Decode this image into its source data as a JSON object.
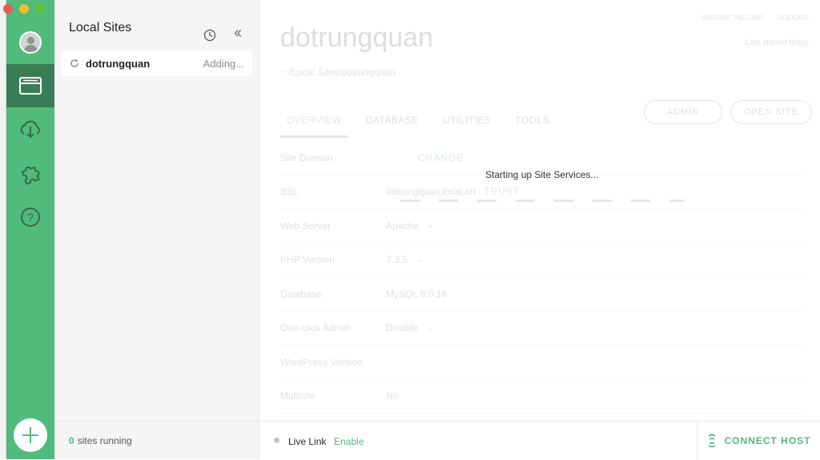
{
  "window": {
    "controls": [
      "close",
      "minimize",
      "maximize"
    ]
  },
  "sidebar": {
    "items": [
      {
        "icon": "sites-icon",
        "active": true
      },
      {
        "icon": "cloud-download-icon",
        "active": false
      },
      {
        "icon": "addons-puzzle-icon",
        "active": false
      },
      {
        "icon": "help-icon",
        "active": false
      }
    ],
    "add_icon": "plus-icon",
    "accent": "#51bb7b",
    "active_bg": "#3a7d55"
  },
  "sites_panel": {
    "title": "Local Sites",
    "sites": [
      {
        "name": "dotrungquan",
        "status": "Adding..."
      }
    ],
    "footer_count": "0",
    "footer_text": "sites running"
  },
  "main": {
    "site_title": "dotrungquan",
    "site_path": "~/Local Sites/dotrungquan",
    "top_actions": [
      "INSTANT RELOAD",
      "ADDONS"
    ],
    "top_note": "Last started today",
    "buttons": {
      "admin": "ADMIN",
      "open_site": "OPEN SITE"
    },
    "tabs": [
      "OVERVIEW",
      "DATABASE",
      "UTILITIES",
      "TOOLS"
    ],
    "active_tab": "OVERVIEW",
    "rows": [
      {
        "label": "Site Domain",
        "value": "",
        "extra": "CHANGE"
      },
      {
        "label": "SSL",
        "value": "dotrungquan.local.crt",
        "extra": "TRUST"
      },
      {
        "label": "Web Server",
        "value": "Apache",
        "extra": ""
      },
      {
        "label": "PHP Version",
        "value": "7.3.5",
        "extra": ""
      },
      {
        "label": "Database",
        "value": "MySQL 8.0.16",
        "extra": ""
      },
      {
        "label": "One-click Admin",
        "value": "Disable",
        "extra": ""
      },
      {
        "label": "WordPress Version",
        "value": "",
        "extra": ""
      },
      {
        "label": "Multisite",
        "value": "No",
        "extra": ""
      }
    ],
    "loader_text": "Starting up Site Services..."
  },
  "bottom_bar": {
    "live_link_label": "Live Link",
    "live_link_action": "Enable",
    "connect_host": "CONNECT HOST"
  }
}
